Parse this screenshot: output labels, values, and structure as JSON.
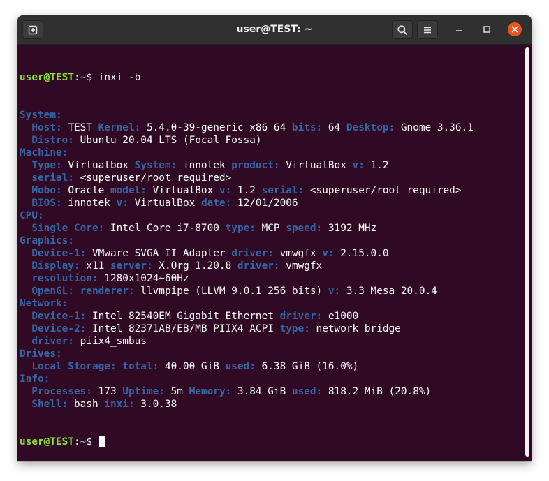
{
  "window": {
    "title": "user@TEST: ~",
    "icons": {
      "new_tab": "new-tab-icon",
      "search": "search-icon",
      "menu": "hamburger-menu-icon",
      "minimize": "minimize-icon",
      "maximize": "maximize-icon",
      "close": "close-icon"
    },
    "colors": {
      "terminal_bg": "#300a24",
      "titlebar_bg": "#303030",
      "close_button": "#e95420",
      "prompt_user": "#8ae234",
      "prompt_path": "#729fcf",
      "section_heading": "#3465a4",
      "field_key": "#3465a4",
      "text": "#ffffff"
    }
  },
  "terminal": {
    "prompt1": {
      "user": "user@TEST",
      "sep": ":",
      "path": "~",
      "symbol": "$ ",
      "command": "inxi -b"
    },
    "lines": [
      {
        "segments": [
          {
            "t": "System:",
            "c": "bl"
          }
        ]
      },
      {
        "segments": [
          {
            "t": "  "
          },
          {
            "t": "Host:",
            "c": "bl"
          },
          {
            "t": " TEST "
          },
          {
            "t": "Kernel:",
            "c": "bl"
          },
          {
            "t": " 5.4.0-39-generic x86_64 "
          },
          {
            "t": "bits:",
            "c": "bl"
          },
          {
            "t": " 64 "
          },
          {
            "t": "Desktop:",
            "c": "bl"
          },
          {
            "t": " Gnome 3.36.1"
          }
        ]
      },
      {
        "segments": [
          {
            "t": "  "
          },
          {
            "t": "Distro:",
            "c": "bl"
          },
          {
            "t": " Ubuntu 20.04 LTS (Focal Fossa)"
          }
        ]
      },
      {
        "segments": [
          {
            "t": "Machine:",
            "c": "bl"
          }
        ]
      },
      {
        "segments": [
          {
            "t": "  "
          },
          {
            "t": "Type:",
            "c": "bl"
          },
          {
            "t": " Virtualbox "
          },
          {
            "t": "System:",
            "c": "bl"
          },
          {
            "t": " innotek "
          },
          {
            "t": "product:",
            "c": "bl"
          },
          {
            "t": " VirtualBox "
          },
          {
            "t": "v:",
            "c": "bl"
          },
          {
            "t": " 1.2"
          }
        ]
      },
      {
        "segments": [
          {
            "t": "  "
          },
          {
            "t": "serial:",
            "c": "bl"
          },
          {
            "t": " <superuser/root required>"
          }
        ]
      },
      {
        "segments": [
          {
            "t": "  "
          },
          {
            "t": "Mobo:",
            "c": "bl"
          },
          {
            "t": " Oracle "
          },
          {
            "t": "model:",
            "c": "bl"
          },
          {
            "t": " VirtualBox "
          },
          {
            "t": "v:",
            "c": "bl"
          },
          {
            "t": " 1.2 "
          },
          {
            "t": "serial:",
            "c": "bl"
          },
          {
            "t": " <superuser/root required>"
          }
        ]
      },
      {
        "segments": [
          {
            "t": "  "
          },
          {
            "t": "BIOS:",
            "c": "bl"
          },
          {
            "t": " innotek "
          },
          {
            "t": "v:",
            "c": "bl"
          },
          {
            "t": " VirtualBox "
          },
          {
            "t": "date:",
            "c": "bl"
          },
          {
            "t": " 12/01/2006"
          }
        ]
      },
      {
        "segments": [
          {
            "t": "CPU:",
            "c": "bl"
          }
        ]
      },
      {
        "segments": [
          {
            "t": "  "
          },
          {
            "t": "Single Core:",
            "c": "bl"
          },
          {
            "t": " Intel Core i7-8700 "
          },
          {
            "t": "type:",
            "c": "bl"
          },
          {
            "t": " MCP "
          },
          {
            "t": "speed:",
            "c": "bl"
          },
          {
            "t": " 3192 MHz"
          }
        ]
      },
      {
        "segments": [
          {
            "t": "Graphics:",
            "c": "bl"
          }
        ]
      },
      {
        "segments": [
          {
            "t": "  "
          },
          {
            "t": "Device-1:",
            "c": "bl"
          },
          {
            "t": " VMware SVGA II Adapter "
          },
          {
            "t": "driver:",
            "c": "bl"
          },
          {
            "t": " vmwgfx "
          },
          {
            "t": "v:",
            "c": "bl"
          },
          {
            "t": " 2.15.0.0"
          }
        ]
      },
      {
        "segments": [
          {
            "t": "  "
          },
          {
            "t": "Display:",
            "c": "bl"
          },
          {
            "t": " x11 "
          },
          {
            "t": "server:",
            "c": "bl"
          },
          {
            "t": " X.Org 1.20.8 "
          },
          {
            "t": "driver:",
            "c": "bl"
          },
          {
            "t": " vmwgfx"
          }
        ]
      },
      {
        "segments": [
          {
            "t": "  "
          },
          {
            "t": "resolution:",
            "c": "bl"
          },
          {
            "t": " 1280x1024~60Hz"
          }
        ]
      },
      {
        "segments": [
          {
            "t": "  "
          },
          {
            "t": "OpenGL:",
            "c": "bl"
          },
          {
            "t": " "
          },
          {
            "t": "renderer:",
            "c": "bl"
          },
          {
            "t": " llvmpipe (LLVM 9.0.1 256 bits) "
          },
          {
            "t": "v:",
            "c": "bl"
          },
          {
            "t": " 3.3 Mesa 20.0.4"
          }
        ]
      },
      {
        "segments": [
          {
            "t": "Network:",
            "c": "bl"
          }
        ]
      },
      {
        "segments": [
          {
            "t": "  "
          },
          {
            "t": "Device-1:",
            "c": "bl"
          },
          {
            "t": " Intel 82540EM Gigabit Ethernet "
          },
          {
            "t": "driver:",
            "c": "bl"
          },
          {
            "t": " e1000"
          }
        ]
      },
      {
        "segments": [
          {
            "t": "  "
          },
          {
            "t": "Device-2:",
            "c": "bl"
          },
          {
            "t": " Intel 82371AB/EB/MB PIIX4 ACPI "
          },
          {
            "t": "type:",
            "c": "bl"
          },
          {
            "t": " network bridge"
          }
        ]
      },
      {
        "segments": [
          {
            "t": "  "
          },
          {
            "t": "driver:",
            "c": "bl"
          },
          {
            "t": " piix4_smbus"
          }
        ]
      },
      {
        "segments": [
          {
            "t": "Drives:",
            "c": "bl"
          }
        ]
      },
      {
        "segments": [
          {
            "t": "  "
          },
          {
            "t": "Local Storage:",
            "c": "bl"
          },
          {
            "t": " "
          },
          {
            "t": "total:",
            "c": "bl"
          },
          {
            "t": " 40.00 GiB "
          },
          {
            "t": "used:",
            "c": "bl"
          },
          {
            "t": " 6.38 GiB (16.0%)"
          }
        ]
      },
      {
        "segments": [
          {
            "t": "Info:",
            "c": "bl"
          }
        ]
      },
      {
        "segments": [
          {
            "t": "  "
          },
          {
            "t": "Processes:",
            "c": "bl"
          },
          {
            "t": " 173 "
          },
          {
            "t": "Uptime:",
            "c": "bl"
          },
          {
            "t": " 5m "
          },
          {
            "t": "Memory:",
            "c": "bl"
          },
          {
            "t": " 3.84 GiB "
          },
          {
            "t": "used:",
            "c": "bl"
          },
          {
            "t": " 818.2 MiB (20.8%)"
          }
        ]
      },
      {
        "segments": [
          {
            "t": "  "
          },
          {
            "t": "Shell:",
            "c": "bl"
          },
          {
            "t": " bash "
          },
          {
            "t": "inxi:",
            "c": "bl"
          },
          {
            "t": " 3.0.38"
          }
        ]
      }
    ],
    "prompt2": {
      "user": "user@TEST",
      "sep": ":",
      "path": "~",
      "symbol": "$ "
    }
  }
}
